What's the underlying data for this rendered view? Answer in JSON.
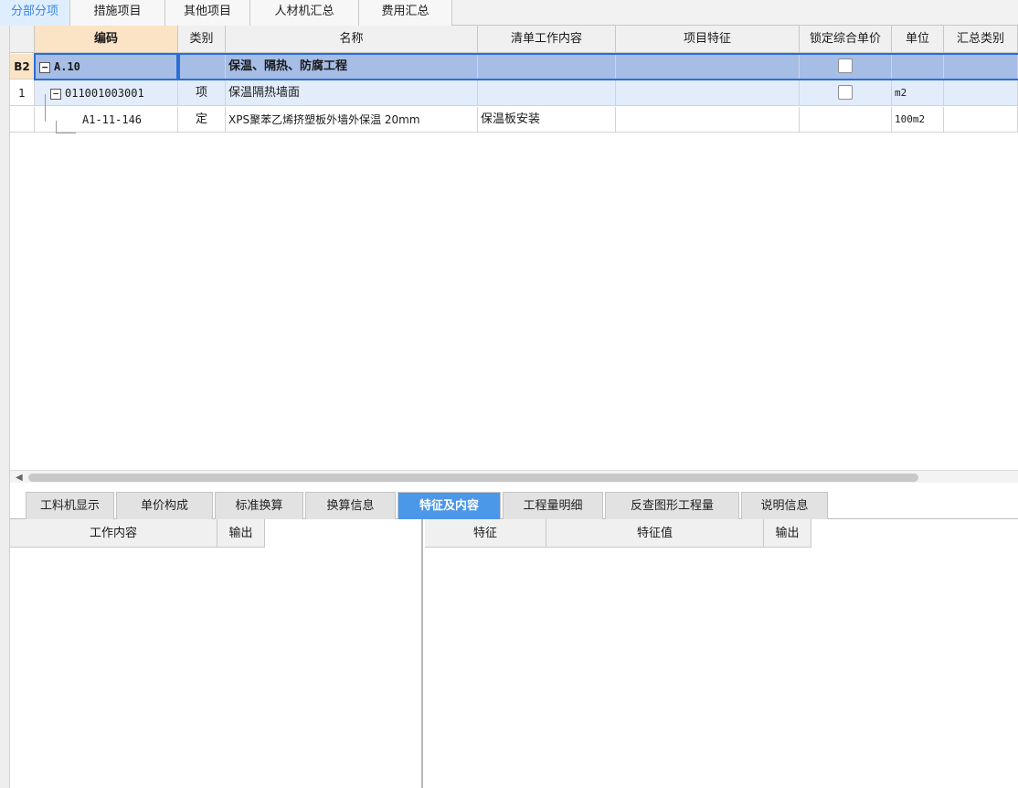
{
  "top_tabs": [
    "分部分项",
    "措施项目",
    "其他项目",
    "人材机汇总",
    "费用汇总"
  ],
  "grid": {
    "headers": [
      "编码",
      "类别",
      "名称",
      "清单工作内容",
      "项目特征",
      "锁定综合单价",
      "单位",
      "汇总类别"
    ],
    "rows": [
      {
        "rowhead": "B2",
        "code": "A.10",
        "type": "",
        "name": "保温、隔热、防腐工程",
        "work": "",
        "feature": "",
        "unit": "",
        "summary": ""
      },
      {
        "rowhead": "1",
        "code": "011001003001",
        "type": "项",
        "name": "保温隔热墙面",
        "work": "",
        "feature": "",
        "unit": "m2",
        "summary": ""
      },
      {
        "rowhead": "",
        "code": "A1-11-146",
        "type": "定",
        "name": "XPS聚苯乙烯挤塑板外墙外保温 20mm",
        "work": "保温板安装",
        "feature": "",
        "unit": "100m2",
        "summary": ""
      }
    ]
  },
  "bottom_tabs": [
    "工料机显示",
    "单价构成",
    "标准换算",
    "换算信息",
    "特征及内容",
    "工程量明细",
    "反查图形工程量",
    "说明信息"
  ],
  "left_panel": {
    "headers": [
      "工作内容",
      "输出"
    ]
  },
  "right_panel": {
    "headers": [
      "特征",
      "特征值",
      "输出"
    ]
  },
  "colors": {
    "accent": "#4b97e8",
    "selected_row": "#a6bde6",
    "code_header": "#fbe3c6"
  }
}
